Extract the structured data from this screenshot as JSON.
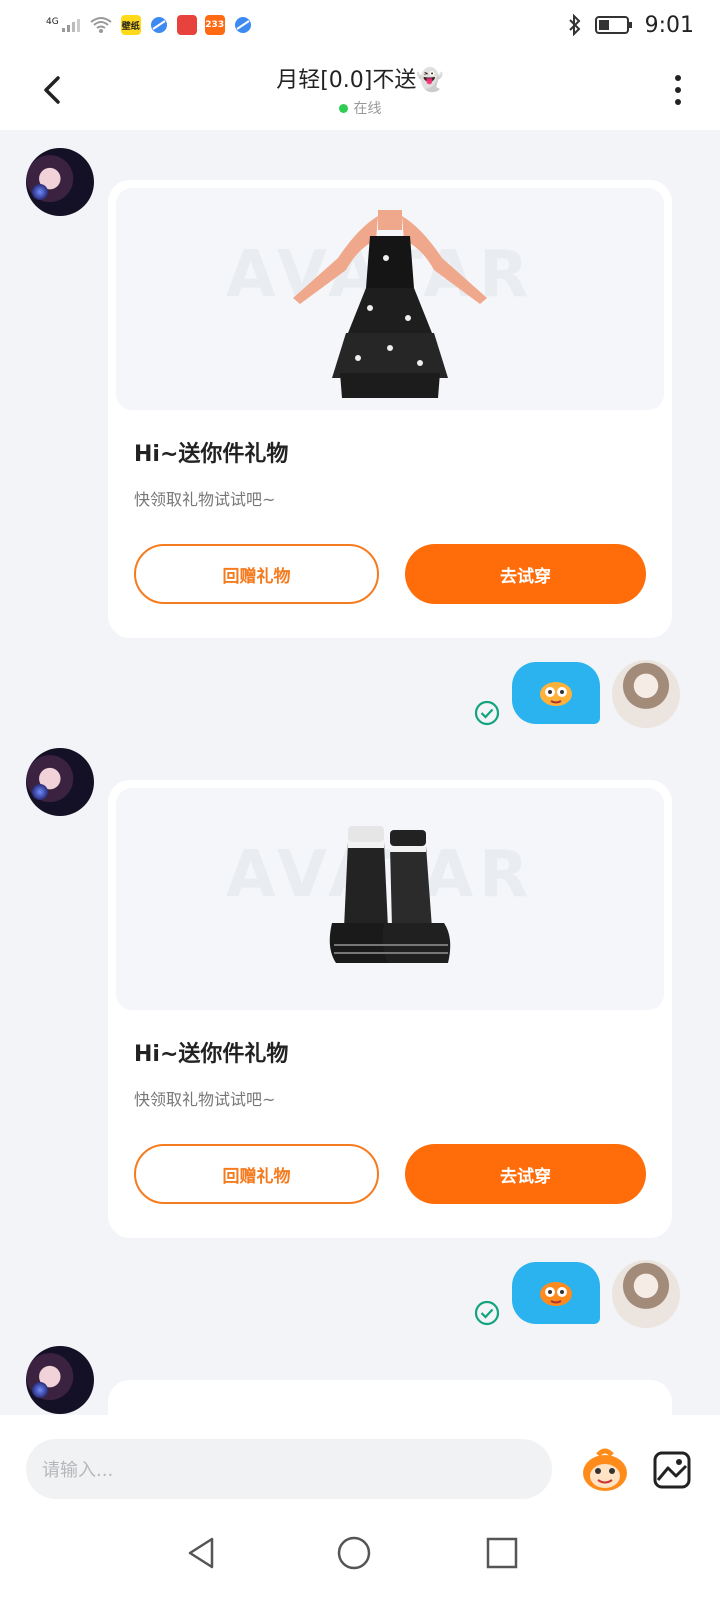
{
  "status_bar": {
    "network": "4G",
    "app_badges": [
      "壁纸",
      "",
      "",
      "233",
      ""
    ],
    "time": "9:01"
  },
  "header": {
    "title": "月轻[0.0]不送👻",
    "status": "在线"
  },
  "messages": [
    {
      "type": "gift_card",
      "item": "dress",
      "title": "Hi~送你件礼物",
      "subtitle": "快领取礼物试试吧~",
      "return_label": "回赠礼物",
      "try_label": "去试穿"
    },
    {
      "type": "sticker",
      "sticker": "tiger-face"
    },
    {
      "type": "gift_card",
      "item": "boots",
      "title": "Hi~送你件礼物",
      "subtitle": "快领取礼物试试吧~",
      "return_label": "回赠礼物",
      "try_label": "去试穿"
    },
    {
      "type": "sticker",
      "sticker": "tiger-face"
    }
  ],
  "input": {
    "placeholder": "请输入..."
  },
  "colors": {
    "accent": "#ff6d0a",
    "bubble": "#2bb3f0",
    "online": "#2ecc51",
    "check": "#12a37f"
  },
  "watermark": "AVATAR"
}
